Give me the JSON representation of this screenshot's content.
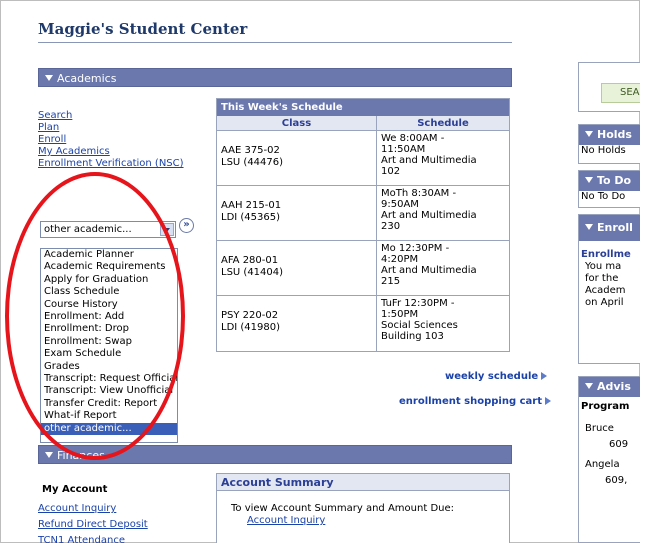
{
  "page": {
    "title": "Maggie's Student Center"
  },
  "academics": {
    "header": "Academics",
    "links": [
      "Search",
      "Plan",
      "Enroll",
      "My Academics",
      "Enrollment Verification (NSC)"
    ],
    "select": {
      "value": "other academic...",
      "go_label": "»",
      "options": [
        "Academic Planner",
        "Academic Requirements",
        "Apply for Graduation",
        "Class Schedule",
        "Course History",
        "Enrollment: Add",
        "Enrollment: Drop",
        "Enrollment: Swap",
        "Exam Schedule",
        "Grades",
        "Transcript: Request Official",
        "Transcript: View Unofficial",
        "Transfer Credit: Report",
        "What-if Report",
        "other academic..."
      ]
    }
  },
  "schedule": {
    "title": "This Week's Schedule",
    "col_class": "Class",
    "col_schedule": "Schedule",
    "rows": [
      {
        "class": "AAE 375-02",
        "section": "LSU (44476)",
        "l1": "We 8:00AM -",
        "l2": "11:50AM",
        "l3": "Art and Multimedia",
        "l4": "102"
      },
      {
        "class": "AAH 215-01",
        "section": "LDI (45365)",
        "l1": "MoTh 8:30AM -",
        "l2": "9:50AM",
        "l3": "Art and Multimedia",
        "l4": "230"
      },
      {
        "class": "AFA 280-01",
        "section": "LSU (41404)",
        "l1": "Mo 12:30PM -",
        "l2": "4:20PM",
        "l3": "Art and Multimedia",
        "l4": "215"
      },
      {
        "class": "PSY 220-02",
        "section": "LDI (41980)",
        "l1": "TuFr 12:30PM -",
        "l2": "1:50PM",
        "l3": "Social Sciences",
        "l4": "Building 103"
      }
    ],
    "weekly_link": "weekly schedule",
    "cart_link": "enrollment shopping cart"
  },
  "finances": {
    "header": "Finances",
    "my_account": "My Account",
    "links": [
      "Account Inquiry",
      "Refund Direct Deposit",
      "TCN1 Attendance"
    ],
    "summary_title": "Account Summary",
    "summary_text": "To view Account Summary and Amount Due:",
    "summary_link": "Account Inquiry"
  },
  "sidebar": {
    "search_label": "SEA",
    "holds_header": "Holds",
    "holds_text": "No Holds",
    "todo_header": "To Do",
    "todo_text": "No To Do",
    "enroll_header": "Enroll",
    "enroll_title": "Enrollme",
    "enroll_lines": [
      "You ma",
      "for the",
      "Academ",
      "on April"
    ],
    "advisor_header": "Advis",
    "advisor_program": "Program",
    "advisors": [
      "Bruce",
      "609",
      "Angela",
      "609,"
    ]
  },
  "colors": {
    "header_bar": "#6b78ad",
    "link": "#1b42a8",
    "annotation": "#e6141b"
  }
}
